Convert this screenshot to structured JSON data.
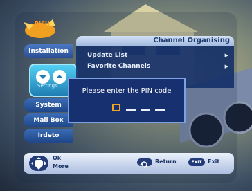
{
  "logo": {
    "text": "RICH"
  },
  "header": {
    "title": "Channel Organising"
  },
  "sidebar": {
    "items": [
      {
        "label": "Installation"
      },
      {
        "label": "System"
      },
      {
        "label": "Mail Box"
      },
      {
        "label": "Irdeto"
      }
    ],
    "selected_icon_label": "Settings"
  },
  "list": {
    "items": [
      {
        "label": "Update List"
      },
      {
        "label": "Favorite Channels"
      }
    ]
  },
  "dialog": {
    "message": "Please enter the PIN code"
  },
  "footer": {
    "ok_label": "Ok",
    "more_label": "More",
    "return_label": "Return",
    "exit_key": "EXIT",
    "exit_label": "Exit"
  }
}
